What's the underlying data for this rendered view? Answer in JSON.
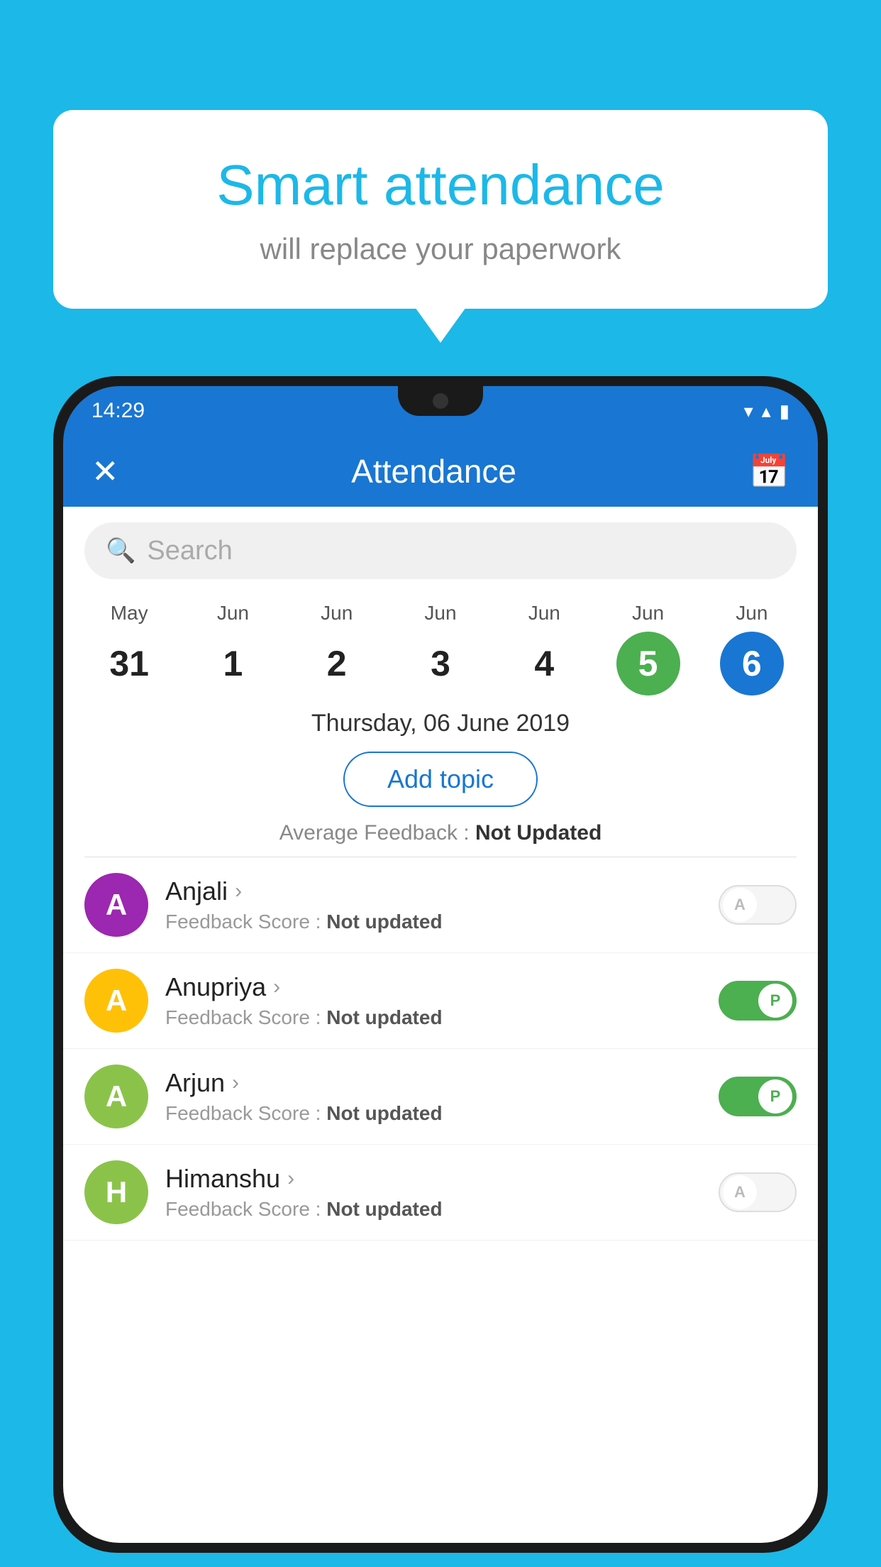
{
  "background_color": "#1cb8e8",
  "bubble": {
    "title": "Smart attendance",
    "subtitle": "will replace your paperwork"
  },
  "phone": {
    "status_bar": {
      "time": "14:29",
      "wifi_icon": "▼",
      "signal_icon": "▲",
      "battery_icon": "▮"
    },
    "app_bar": {
      "close_icon": "✕",
      "title": "Attendance",
      "calendar_icon": "📅"
    },
    "search": {
      "placeholder": "Search"
    },
    "dates": [
      {
        "month": "May",
        "day": "31",
        "state": "normal"
      },
      {
        "month": "Jun",
        "day": "1",
        "state": "normal"
      },
      {
        "month": "Jun",
        "day": "2",
        "state": "normal"
      },
      {
        "month": "Jun",
        "day": "3",
        "state": "normal"
      },
      {
        "month": "Jun",
        "day": "4",
        "state": "normal"
      },
      {
        "month": "Jun",
        "day": "5",
        "state": "today"
      },
      {
        "month": "Jun",
        "day": "6",
        "state": "selected"
      }
    ],
    "selected_date_label": "Thursday, 06 June 2019",
    "add_topic_btn": "Add topic",
    "avg_feedback_label": "Average Feedback : ",
    "avg_feedback_value": "Not Updated",
    "students": [
      {
        "name": "Anjali",
        "avatar_letter": "A",
        "avatar_color": "#9c27b0",
        "feedback_label": "Feedback Score : ",
        "feedback_value": "Not updated",
        "attendance": "absent",
        "toggle_label": "A"
      },
      {
        "name": "Anupriya",
        "avatar_letter": "A",
        "avatar_color": "#ffc107",
        "feedback_label": "Feedback Score : ",
        "feedback_value": "Not updated",
        "attendance": "present",
        "toggle_label": "P"
      },
      {
        "name": "Arjun",
        "avatar_letter": "A",
        "avatar_color": "#8bc34a",
        "feedback_label": "Feedback Score : ",
        "feedback_value": "Not updated",
        "attendance": "present",
        "toggle_label": "P"
      },
      {
        "name": "Himanshu",
        "avatar_letter": "H",
        "avatar_color": "#8bc34a",
        "feedback_label": "Feedback Score : ",
        "feedback_value": "Not updated",
        "attendance": "absent",
        "toggle_label": "A"
      }
    ]
  }
}
